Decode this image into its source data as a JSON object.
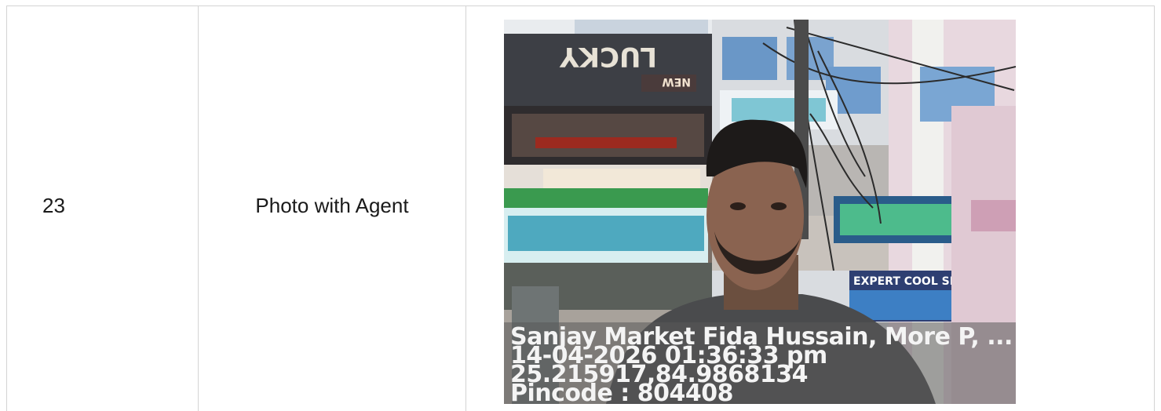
{
  "row": {
    "number": "23",
    "label": "Photo with Agent"
  },
  "photo": {
    "description_icon": "selfie-photo",
    "signs": {
      "top_sign": "LUCKY",
      "top_sign_side": "NEW",
      "right_sign": "EXPERT COOL SERVICES"
    },
    "stamp": {
      "location": "Sanjay Market Fida Hussain, More P, ...",
      "datetime": "14-04-2026 01:36:33 pm",
      "coordinates": "25.215917,84.9868134",
      "pincode": "Pincode : 804408"
    }
  },
  "colors": {
    "border": "#d4d4d4",
    "text": "#1a1a1a",
    "stamp_text": "#f4f4f4"
  }
}
